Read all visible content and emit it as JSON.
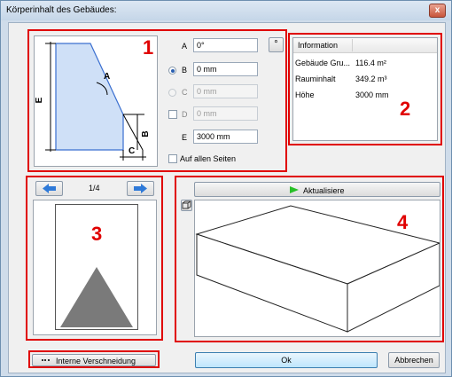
{
  "window": {
    "title": "Körperinhalt des Gebäudes:",
    "close_glyph": "x"
  },
  "section1": {
    "number": "1",
    "diagram_labels": {
      "a": "A",
      "b": "B",
      "c": "C",
      "e": "E"
    },
    "fields": [
      {
        "label": "A",
        "value": "0°",
        "enabled": true
      },
      {
        "label": "B",
        "value": "0 mm",
        "enabled": true,
        "radio": "selected"
      },
      {
        "label": "C",
        "value": "0 mm",
        "enabled": false,
        "radio": "unselected"
      },
      {
        "label": "D",
        "value": "0 mm",
        "enabled": false,
        "checkbox": "unchecked"
      },
      {
        "label": "E",
        "value": "3000 mm",
        "enabled": true
      }
    ],
    "degree_button": "°",
    "all_sides_label": "Auf allen Seiten"
  },
  "section2": {
    "number": "2",
    "header": "Information",
    "rows": [
      {
        "name": "Gebäude Gru...",
        "value": "116.4 m²"
      },
      {
        "name": "Rauminhalt",
        "value": "349.2 m³"
      },
      {
        "name": "Höhe",
        "value": "3000 mm"
      }
    ]
  },
  "section3": {
    "number": "3",
    "page_indicator": "1/4"
  },
  "section4": {
    "number": "4",
    "refresh_label": "Aktualisiere"
  },
  "buttons": {
    "internal": "Interne Verschneidung",
    "ok": "Ok",
    "cancel": "Abbrechen"
  },
  "colors": {
    "accent_red": "#e00000",
    "shape_fill": "#cfe0f7",
    "arrow_blue": "#2f7ad8",
    "refresh_green": "#27c027"
  }
}
